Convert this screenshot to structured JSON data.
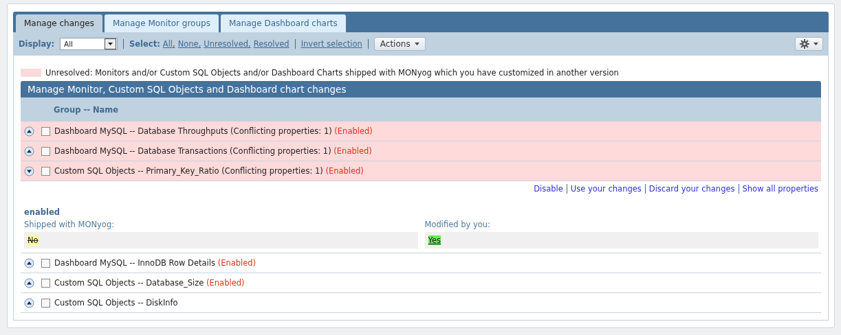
{
  "tabs": [
    {
      "label": "Manage changes",
      "selected": true
    },
    {
      "label": "Manage Monitor groups",
      "selected": false
    },
    {
      "label": "Manage Dashboard charts",
      "selected": false
    }
  ],
  "toolbar": {
    "display_label": "Display:",
    "display_value": "All",
    "select_label": "Select:",
    "select_links": [
      "All,",
      "None,",
      "Unresolved,",
      "Resolved"
    ],
    "invert_link": "Invert selection",
    "actions_button": "Actions"
  },
  "legend": {
    "text": "Unresolved: Monitors and/or Custom SQL Objects and/or Dashboard Charts shipped with MONyog which you have customized in another version"
  },
  "table": {
    "title": "Manage Monitor, Custom SQL Objects and Dashboard chart changes",
    "column": "Group -- Name",
    "rows": [
      {
        "text": "Dashboard MySQL -- Database Throughputs (Conflicting properties: 1)",
        "status": "(Enabled)",
        "unresolved": true,
        "expanded": false,
        "checked": false
      },
      {
        "text": "Dashboard MySQL -- Database Transactions (Conflicting properties: 1)",
        "status": "(Enabled)",
        "unresolved": true,
        "expanded": false,
        "checked": false
      },
      {
        "text": "Custom SQL Objects -- Primary_Key_Ratio (Conflicting properties: 1)",
        "status": "(Enabled)",
        "unresolved": true,
        "expanded": true,
        "checked": false,
        "detail": {
          "links": [
            "Disable",
            "Use your changes",
            "Discard your changes",
            "Show all properties"
          ],
          "property": "enabled",
          "shipped_label": "Shipped with MONyog:",
          "shipped_value": "No",
          "modified_label": "Modified by you:",
          "modified_value": "Yes"
        }
      },
      {
        "text": "Dashboard MySQL -- InnoDB Row Details",
        "status": "(Enabled)",
        "unresolved": false,
        "expanded": false,
        "checked": false
      },
      {
        "text": "Custom SQL Objects -- Database_Size",
        "status": "(Enabled)",
        "unresolved": false,
        "expanded": false,
        "checked": false
      },
      {
        "text": "Custom SQL Objects -- DiskInfo",
        "unresolved": false,
        "expanded": false,
        "checked": false
      }
    ]
  }
}
